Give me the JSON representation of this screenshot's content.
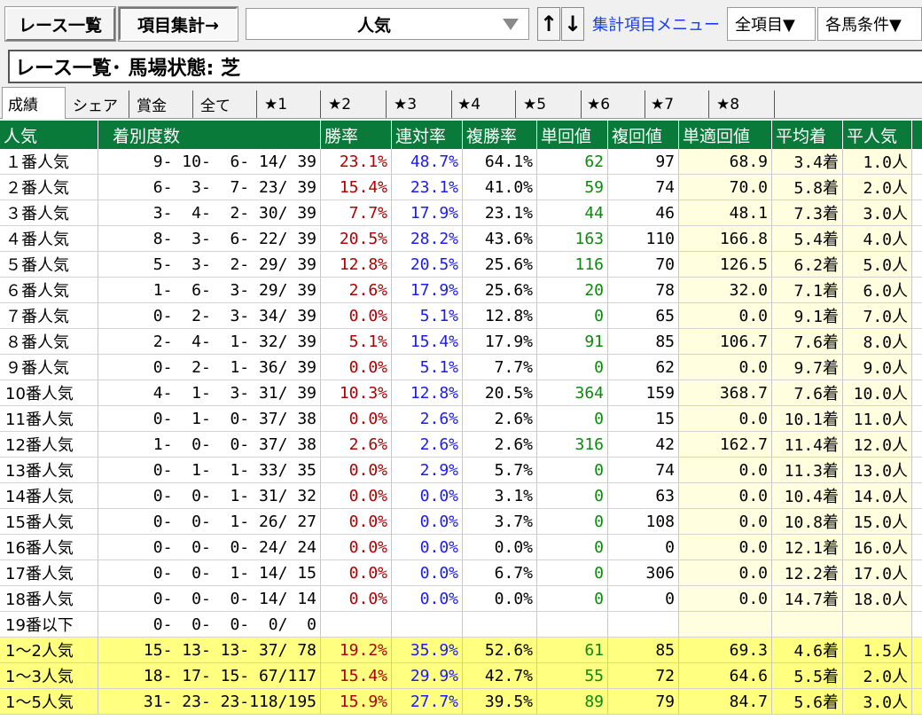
{
  "toolbar": {
    "race_list_label": "レース一覧",
    "item_agg_label": "項目集計→",
    "combo_value": "人気",
    "up_label": "↑",
    "down_label": "↓",
    "menu_label": "集計項目メニュー",
    "all_items_label": "全項目▼",
    "conditions_label": "各馬条件▼"
  },
  "title": "レース一覧･ 馬場状態: 芝",
  "tabs": [
    "成績",
    "シェア",
    "賞金",
    "全て",
    "★1",
    "★2",
    "★3",
    "★4",
    "★5",
    "★6",
    "★7",
    "★8"
  ],
  "columns": [
    "人気",
    "着別度数",
    "勝率",
    "連対率",
    "複勝率",
    "単回値",
    "複回値",
    "単適回値",
    "平均着",
    "平人気"
  ],
  "rows": [
    {
      "pop": "１番人気",
      "cnt": "9- 10-  6- 14/ 39",
      "win": "23.1%",
      "ren": "48.7%",
      "fuku": "64.1%",
      "tan": "62",
      "fkv": "97",
      "tekv": "68.9",
      "avg": "3.4着",
      "avgpop": "1.0人"
    },
    {
      "pop": "２番人気",
      "cnt": "6-  3-  7- 23/ 39",
      "win": "15.4%",
      "ren": "23.1%",
      "fuku": "41.0%",
      "tan": "59",
      "fkv": "74",
      "tekv": "70.0",
      "avg": "5.8着",
      "avgpop": "2.0人"
    },
    {
      "pop": "３番人気",
      "cnt": "3-  4-  2- 30/ 39",
      "win": "7.7%",
      "ren": "17.9%",
      "fuku": "23.1%",
      "tan": "44",
      "fkv": "46",
      "tekv": "48.1",
      "avg": "7.3着",
      "avgpop": "3.0人"
    },
    {
      "pop": "４番人気",
      "cnt": "8-  3-  6- 22/ 39",
      "win": "20.5%",
      "ren": "28.2%",
      "fuku": "43.6%",
      "tan": "163",
      "fkv": "110",
      "tekv": "166.8",
      "avg": "5.4着",
      "avgpop": "4.0人"
    },
    {
      "pop": "５番人気",
      "cnt": "5-  3-  2- 29/ 39",
      "win": "12.8%",
      "ren": "20.5%",
      "fuku": "25.6%",
      "tan": "116",
      "fkv": "70",
      "tekv": "126.5",
      "avg": "6.2着",
      "avgpop": "5.0人"
    },
    {
      "pop": "６番人気",
      "cnt": "1-  6-  3- 29/ 39",
      "win": "2.6%",
      "ren": "17.9%",
      "fuku": "25.6%",
      "tan": "20",
      "fkv": "78",
      "tekv": "32.0",
      "avg": "7.1着",
      "avgpop": "6.0人"
    },
    {
      "pop": "７番人気",
      "cnt": "0-  2-  3- 34/ 39",
      "win": "0.0%",
      "ren": "5.1%",
      "fuku": "12.8%",
      "tan": "0",
      "fkv": "65",
      "tekv": "0.0",
      "avg": "9.1着",
      "avgpop": "7.0人"
    },
    {
      "pop": "８番人気",
      "cnt": "2-  4-  1- 32/ 39",
      "win": "5.1%",
      "ren": "15.4%",
      "fuku": "17.9%",
      "tan": "91",
      "fkv": "85",
      "tekv": "106.7",
      "avg": "7.6着",
      "avgpop": "8.0人"
    },
    {
      "pop": "９番人気",
      "cnt": "0-  2-  1- 36/ 39",
      "win": "0.0%",
      "ren": "5.1%",
      "fuku": "7.7%",
      "tan": "0",
      "fkv": "62",
      "tekv": "0.0",
      "avg": "9.7着",
      "avgpop": "9.0人"
    },
    {
      "pop": "10番人気",
      "cnt": "4-  1-  3- 31/ 39",
      "win": "10.3%",
      "ren": "12.8%",
      "fuku": "20.5%",
      "tan": "364",
      "fkv": "159",
      "tekv": "368.7",
      "avg": "7.6着",
      "avgpop": "10.0人"
    },
    {
      "pop": "11番人気",
      "cnt": "0-  1-  0- 37/ 38",
      "win": "0.0%",
      "ren": "2.6%",
      "fuku": "2.6%",
      "tan": "0",
      "fkv": "15",
      "tekv": "0.0",
      "avg": "10.1着",
      "avgpop": "11.0人"
    },
    {
      "pop": "12番人気",
      "cnt": "1-  0-  0- 37/ 38",
      "win": "2.6%",
      "ren": "2.6%",
      "fuku": "2.6%",
      "tan": "316",
      "fkv": "42",
      "tekv": "162.7",
      "avg": "11.4着",
      "avgpop": "12.0人"
    },
    {
      "pop": "13番人気",
      "cnt": "0-  1-  1- 33/ 35",
      "win": "0.0%",
      "ren": "2.9%",
      "fuku": "5.7%",
      "tan": "0",
      "fkv": "74",
      "tekv": "0.0",
      "avg": "11.3着",
      "avgpop": "13.0人"
    },
    {
      "pop": "14番人気",
      "cnt": "0-  0-  1- 31/ 32",
      "win": "0.0%",
      "ren": "0.0%",
      "fuku": "3.1%",
      "tan": "0",
      "fkv": "63",
      "tekv": "0.0",
      "avg": "10.4着",
      "avgpop": "14.0人"
    },
    {
      "pop": "15番人気",
      "cnt": "0-  0-  1- 26/ 27",
      "win": "0.0%",
      "ren": "0.0%",
      "fuku": "3.7%",
      "tan": "0",
      "fkv": "108",
      "tekv": "0.0",
      "avg": "10.8着",
      "avgpop": "15.0人"
    },
    {
      "pop": "16番人気",
      "cnt": "0-  0-  0- 24/ 24",
      "win": "0.0%",
      "ren": "0.0%",
      "fuku": "0.0%",
      "tan": "0",
      "fkv": "0",
      "tekv": "0.0",
      "avg": "12.1着",
      "avgpop": "16.0人"
    },
    {
      "pop": "17番人気",
      "cnt": "0-  0-  1- 14/ 15",
      "win": "0.0%",
      "ren": "0.0%",
      "fuku": "6.7%",
      "tan": "0",
      "fkv": "306",
      "tekv": "0.0",
      "avg": "12.2着",
      "avgpop": "17.0人"
    },
    {
      "pop": "18番人気",
      "cnt": "0-  0-  0- 14/ 14",
      "win": "0.0%",
      "ren": "0.0%",
      "fuku": "0.0%",
      "tan": "0",
      "fkv": "0",
      "tekv": "0.0",
      "avg": "14.7着",
      "avgpop": "18.0人"
    },
    {
      "pop": "19番以下",
      "cnt": "0-  0-  0-  0/  0",
      "win": "",
      "ren": "",
      "fuku": "",
      "tan": "",
      "fkv": "",
      "tekv": "",
      "avg": "",
      "avgpop": ""
    }
  ],
  "summary_rows": [
    {
      "pop": "1～2人気",
      "cnt": "15- 13- 13- 37/ 78",
      "win": "19.2%",
      "ren": "35.9%",
      "fuku": "52.6%",
      "tan": "61",
      "fkv": "85",
      "tekv": "69.3",
      "avg": "4.6着",
      "avgpop": "1.5人"
    },
    {
      "pop": "1～3人気",
      "cnt": "18- 17- 15- 67/117",
      "win": "15.4%",
      "ren": "29.9%",
      "fuku": "42.7%",
      "tan": "55",
      "fkv": "72",
      "tekv": "64.6",
      "avg": "5.5着",
      "avgpop": "2.0人"
    },
    {
      "pop": "1～5人気",
      "cnt": "31- 23- 23-118/195",
      "win": "15.9%",
      "ren": "27.7%",
      "fuku": "39.5%",
      "tan": "89",
      "fkv": "79",
      "tekv": "84.7",
      "avg": "5.6着",
      "avgpop": "3.0人"
    }
  ],
  "colors": {
    "header_bg": "#0a7a3a",
    "win_color": "#b00000",
    "ren_color": "#1a1aff",
    "tan_color": "#0a8a0a",
    "summary_bg": "#ffff80"
  }
}
